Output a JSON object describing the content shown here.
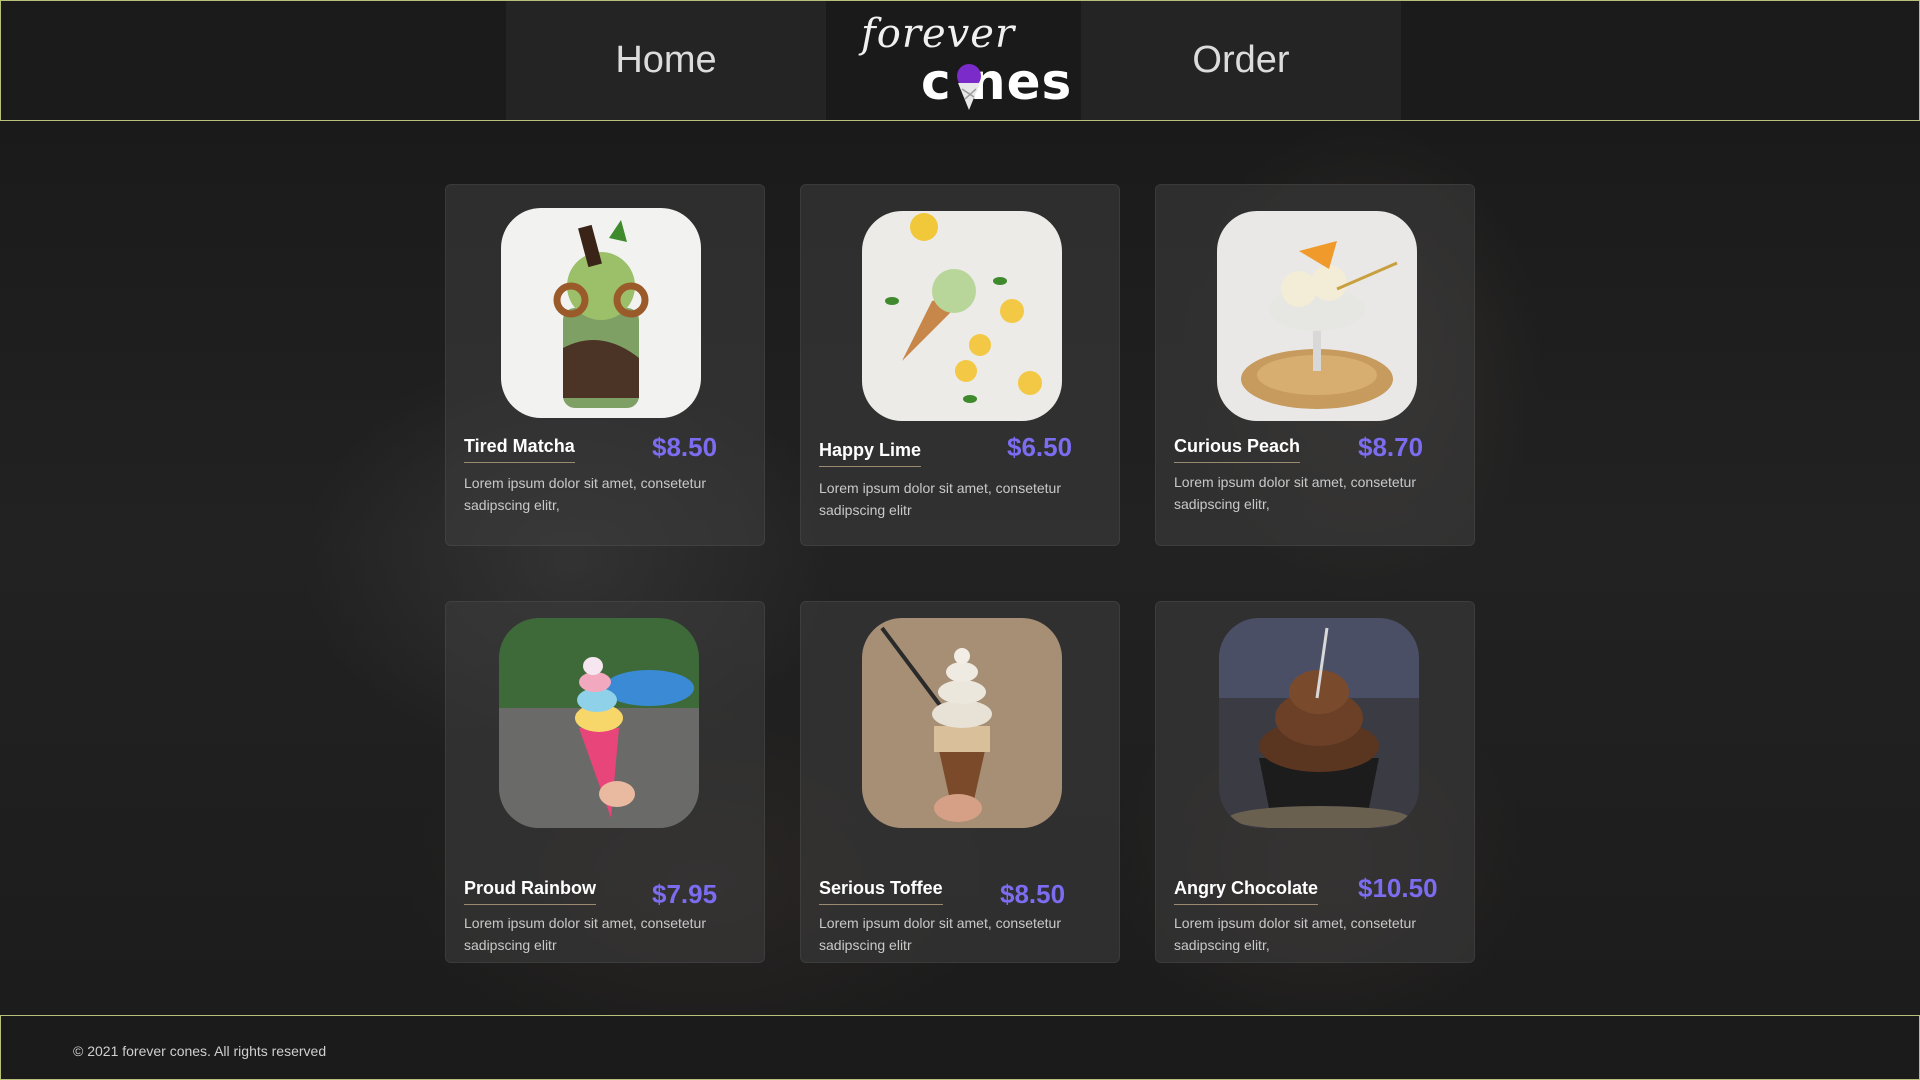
{
  "nav": {
    "home_label": "Home",
    "order_label": "Order",
    "logo": {
      "top": "forever",
      "bottom": "c nes"
    }
  },
  "products": [
    {
      "name": "Tired Matcha",
      "price": "$8.50",
      "description": "Lorem ipsum dolor sit amet, consetetur sadipscing elitr,",
      "image": "matcha-ice-cream-jar"
    },
    {
      "name": "Happy Lime",
      "price": "$6.50",
      "description": "Lorem ipsum dolor sit amet, consetetur sadipscing elitr",
      "image": "lime-ice-cream-cone"
    },
    {
      "name": "Curious Peach",
      "price": "$8.70",
      "description": "Lorem ipsum dolor sit amet, consetetur sadipscing elitr,",
      "image": "peach-ice-cream-glass"
    },
    {
      "name": "Proud Rainbow",
      "price": "$7.95",
      "description": "Lorem ipsum dolor sit amet, consetetur sadipscing elitr",
      "image": "rainbow-ice-cream-cone"
    },
    {
      "name": "Serious Toffee",
      "price": "$8.50",
      "description": "Lorem ipsum dolor sit amet, consetetur sadipscing elitr",
      "image": "toffee-soft-serve-cone"
    },
    {
      "name": "Angry Chocolate",
      "price": "$10.50",
      "description": "Lorem ipsum dolor sit amet, consetetur sadipscing elitr,",
      "image": "chocolate-ice-cream-cup"
    }
  ],
  "footer": {
    "copyright": "© 2021 forever cones.  All rights reserved"
  },
  "colors": {
    "accent": "#7b6cf0",
    "border": "#b9c07a",
    "background": "#1d1d1d"
  }
}
